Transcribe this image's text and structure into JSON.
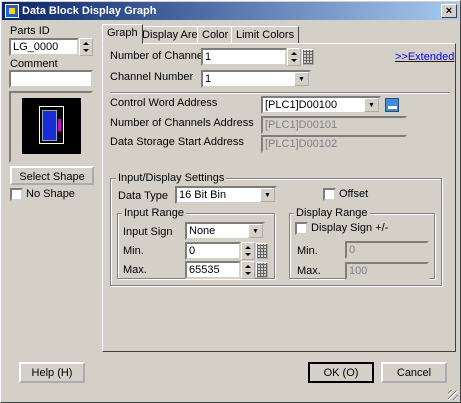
{
  "window": {
    "title": "Data Block Display Graph",
    "close_label": "×"
  },
  "left": {
    "parts_id_label": "Parts ID",
    "parts_id_value": "LG_0000",
    "comment_label": "Comment",
    "comment_value": "",
    "select_shape_label": "Select Shape",
    "no_shape_label": "No Shape",
    "no_shape_checked": false
  },
  "tabs": [
    {
      "label": "Graph",
      "active": true
    },
    {
      "label": "Display Area",
      "active": false
    },
    {
      "label": "Color",
      "active": false
    },
    {
      "label": "Limit Colors",
      "active": false
    }
  ],
  "graph": {
    "num_channels_label": "Number of Channels",
    "num_channels_value": "1",
    "extended_link": ">>Extended",
    "channel_number_label": "Channel Number",
    "channel_number_value": "1",
    "control_word_label": "Control Word Address",
    "control_word_value": "[PLC1]D00100",
    "num_channels_addr_label": "Number of Channels Address",
    "num_channels_addr_value": "[PLC1]D00101",
    "data_storage_label": "Data Storage Start Address",
    "data_storage_value": "[PLC1]D00102"
  },
  "io_settings": {
    "group_title": "Input/Display Settings",
    "data_type_label": "Data Type",
    "data_type_value": "16 Bit Bin",
    "offset_label": "Offset",
    "offset_checked": false
  },
  "input_range": {
    "group_title": "Input Range",
    "input_sign_label": "Input Sign",
    "input_sign_value": "None",
    "min_label": "Min.",
    "min_value": "0",
    "max_label": "Max.",
    "max_value": "65535"
  },
  "display_range": {
    "group_title": "Display Range",
    "display_sign_label": "Display Sign +/-",
    "display_sign_checked": false,
    "min_label": "Min.",
    "min_value": "0",
    "max_label": "Max.",
    "max_value": "100"
  },
  "footer": {
    "help_label": "Help (H)",
    "ok_label": "OK (O)",
    "cancel_label": "Cancel"
  },
  "colors": {
    "title_gradient_start": "#0a246a",
    "preview_background": "#000000",
    "preview_bar": "#1a2bd8",
    "preview_accent": "#d400d4"
  }
}
